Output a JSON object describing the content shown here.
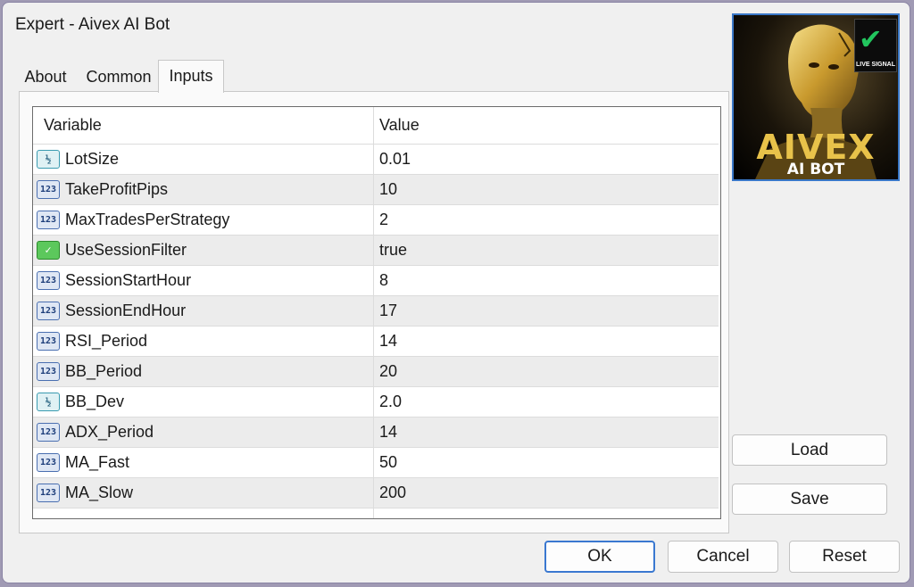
{
  "window": {
    "title": "Expert - Aivex AI Bot"
  },
  "tabs": [
    {
      "label": "About",
      "active": false
    },
    {
      "label": "Common",
      "active": false
    },
    {
      "label": "Inputs",
      "active": true
    }
  ],
  "grid": {
    "columns": {
      "variable": "Variable",
      "value": "Value"
    },
    "rows": [
      {
        "icon": "double-type-icon",
        "icon_text": "½",
        "variable": "LotSize",
        "value": "0.01"
      },
      {
        "icon": "integer-type-icon",
        "icon_text": "123",
        "variable": "TakeProfitPips",
        "value": "10"
      },
      {
        "icon": "integer-type-icon",
        "icon_text": "123",
        "variable": "MaxTradesPerStrategy",
        "value": "2"
      },
      {
        "icon": "boolean-type-icon",
        "icon_text": "✓",
        "variable": "UseSessionFilter",
        "value": "true"
      },
      {
        "icon": "integer-type-icon",
        "icon_text": "123",
        "variable": "SessionStartHour",
        "value": "8"
      },
      {
        "icon": "integer-type-icon",
        "icon_text": "123",
        "variable": "SessionEndHour",
        "value": "17"
      },
      {
        "icon": "integer-type-icon",
        "icon_text": "123",
        "variable": "RSI_Period",
        "value": "14"
      },
      {
        "icon": "integer-type-icon",
        "icon_text": "123",
        "variable": "BB_Period",
        "value": "20"
      },
      {
        "icon": "double-type-icon",
        "icon_text": "½",
        "variable": "BB_Dev",
        "value": "2.0"
      },
      {
        "icon": "integer-type-icon",
        "icon_text": "123",
        "variable": "ADX_Period",
        "value": "14"
      },
      {
        "icon": "integer-type-icon",
        "icon_text": "123",
        "variable": "MA_Fast",
        "value": "50"
      },
      {
        "icon": "integer-type-icon",
        "icon_text": "123",
        "variable": "MA_Slow",
        "value": "200"
      }
    ]
  },
  "logo": {
    "brand": "AIVEX",
    "subtitle": "AI BOT",
    "badge": "LIVE SIGNAL",
    "badge_icon": "checkmark-icon",
    "gold": "#e8c24a",
    "check_green": "#22c55e"
  },
  "side_buttons": {
    "load": "Load",
    "save": "Save"
  },
  "footer_buttons": {
    "ok": "OK",
    "cancel": "Cancel",
    "reset": "Reset"
  },
  "colors": {
    "accent": "#3a78d0",
    "row_alt": "#ececec",
    "window_bg": "#f0f0f0"
  }
}
